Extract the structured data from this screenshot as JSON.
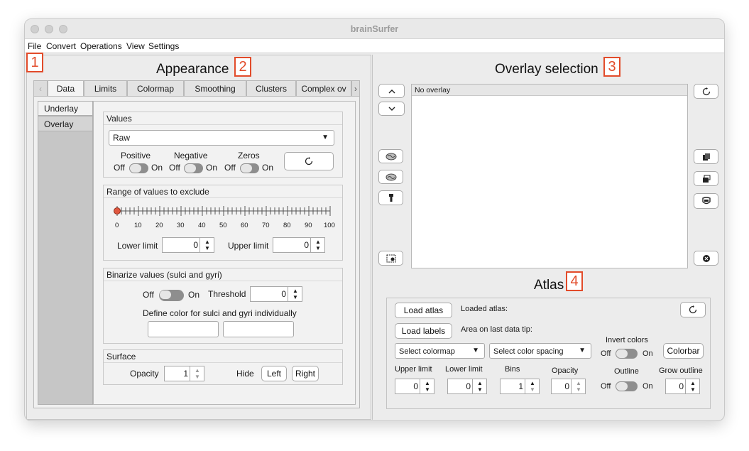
{
  "window": {
    "title": "brainSurfer"
  },
  "menu": [
    "File",
    "Convert",
    "Operations",
    "View",
    "Settings"
  ],
  "markers": [
    "1",
    "2",
    "3",
    "4"
  ],
  "appearance": {
    "heading": "Appearance",
    "tabs": [
      "Data",
      "Limits",
      "Colormap",
      "Smoothing",
      "Clusters",
      "Complex ov"
    ],
    "side_tabs": [
      "Underlay",
      "Overlay"
    ],
    "values": {
      "title": "Values",
      "dropdown": "Raw",
      "positive": "Positive",
      "negative": "Negative",
      "zeros": "Zeros",
      "off": "Off",
      "on": "On"
    },
    "range": {
      "title": "Range of values to exclude",
      "ticks": [
        "0",
        "10",
        "20",
        "30",
        "40",
        "50",
        "60",
        "70",
        "80",
        "90",
        "100"
      ],
      "slider_value": 0,
      "lower_label": "Lower limit",
      "lower_value": "0",
      "upper_label": "Upper limit",
      "upper_value": "0"
    },
    "binarize": {
      "title": "Binarize values (sulci and gyri)",
      "off": "Off",
      "on": "On",
      "threshold_label": "Threshold",
      "threshold_value": "0",
      "define": "Define color for sulci and gyri individually"
    },
    "surface": {
      "title": "Surface",
      "opacity_label": "Opacity",
      "opacity_value": "1",
      "hide_label": "Hide",
      "left": "Left",
      "right": "Right"
    }
  },
  "overlay": {
    "heading": "Overlay selection",
    "list": [
      "No overlay"
    ]
  },
  "atlas": {
    "heading": "Atlas",
    "load_atlas": "Load atlas",
    "loaded_atlas": "Loaded atlas:",
    "load_labels": "Load labels",
    "area_tip": "Area on last data tip:",
    "colormap": "Select colormap",
    "spacing": "Select color spacing",
    "invert": "Invert colors",
    "off": "Off",
    "on": "On",
    "colorbar": "Colorbar",
    "upper_label": "Upper limit",
    "upper_value": "0",
    "lower_label": "Lower limit",
    "lower_value": "0",
    "bins_label": "Bins",
    "bins_value": "1",
    "opacity_label": "Opacity",
    "opacity_value": "0",
    "outline_label": "Outline",
    "grow_label": "Grow outline",
    "grow_value": "0"
  }
}
